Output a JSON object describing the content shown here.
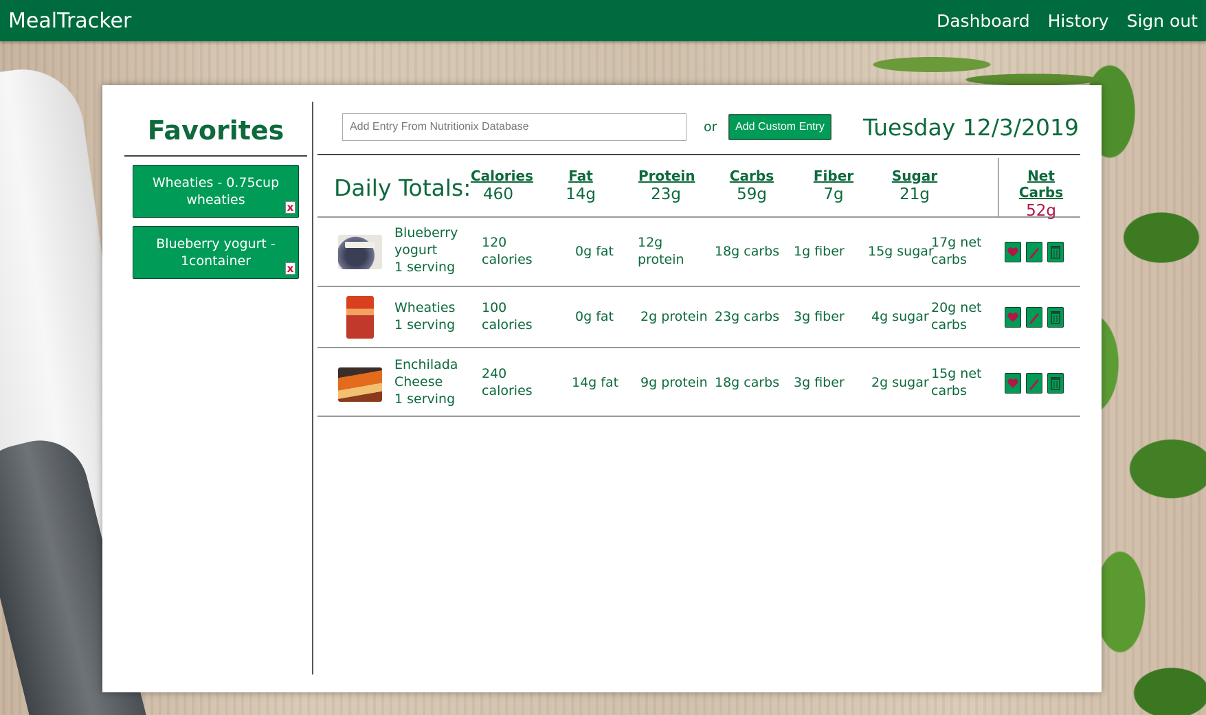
{
  "app": {
    "brand": "MealTracker",
    "nav": [
      "Dashboard",
      "History",
      "Sign out"
    ]
  },
  "sidebar": {
    "title": "Favorites",
    "favorites": [
      {
        "label": "Wheaties - 0.75cup wheaties",
        "remove": "x"
      },
      {
        "label": "Blueberry yogurt - 1container",
        "remove": "x"
      }
    ]
  },
  "toolbar": {
    "search_placeholder": "Add Entry From Nutritionix Database",
    "or": "or",
    "custom_button": "Add Custom Entry",
    "date": "Tuesday 12/3/2019"
  },
  "totals": {
    "title": "Daily Totals:",
    "columns": [
      {
        "label": "Calories",
        "value": "460"
      },
      {
        "label": "Fat",
        "value": "14g"
      },
      {
        "label": "Protein",
        "value": "23g"
      },
      {
        "label": "Carbs",
        "value": "59g"
      },
      {
        "label": "Fiber",
        "value": "7g"
      },
      {
        "label": "Sugar",
        "value": "21g"
      },
      {
        "label": "Net Carbs",
        "value": "52g"
      }
    ]
  },
  "entries": [
    {
      "thumb": "yogurt-image",
      "name": "Blueberry yogurt",
      "serving": "1 serving",
      "calories": "120 calories",
      "fat": "0g fat",
      "protein": "12g protein",
      "carbs": "18g carbs",
      "fiber": "1g fiber",
      "sugar": "15g sugar",
      "net_carbs": "17g net carbs"
    },
    {
      "thumb": "wheaties-image",
      "name": "Wheaties",
      "serving": "1 serving",
      "calories": "100 calories",
      "fat": "0g fat",
      "protein": "2g protein",
      "carbs": "23g carbs",
      "fiber": "3g fiber",
      "sugar": "4g sugar",
      "net_carbs": "20g net carbs"
    },
    {
      "thumb": "enchilada-image",
      "name": "Enchilada Cheese",
      "serving": "1 serving",
      "calories": "240 calories",
      "fat": "14g fat",
      "protein": "9g protein",
      "carbs": "18g carbs",
      "fiber": "3g fiber",
      "sugar": "2g sugar",
      "net_carbs": "15g net carbs"
    }
  ],
  "icons": {
    "favorite": "heart-icon",
    "edit": "pencil-icon",
    "delete": "trash-icon"
  },
  "colors": {
    "primary": "#006b3c",
    "button": "#009b57",
    "text": "#0d6a3c",
    "accent_red": "#b01848"
  }
}
